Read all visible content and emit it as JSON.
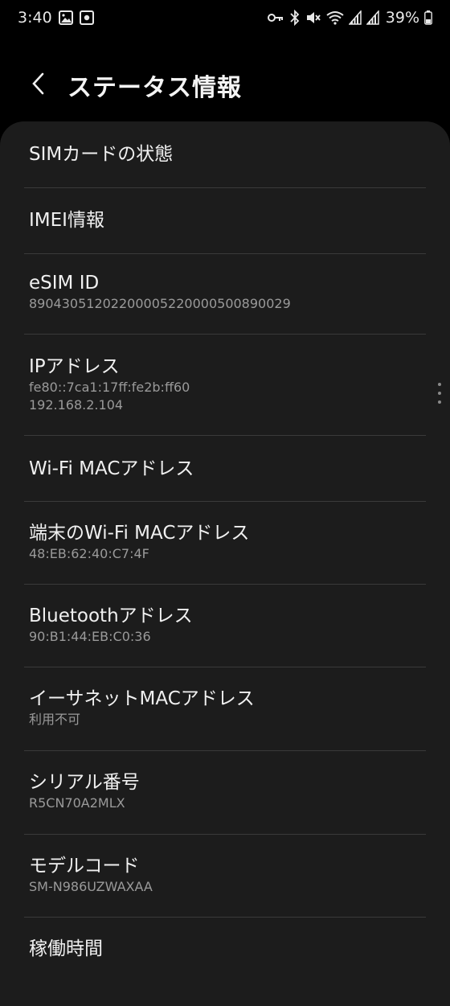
{
  "status_bar": {
    "time": "3:40",
    "battery": "39%"
  },
  "header": {
    "title": "ステータス情報"
  },
  "items": [
    {
      "title": "SIMカードの状態"
    },
    {
      "title": "IMEI情報"
    },
    {
      "title": "eSIM ID",
      "sub": "89043051202200005220000500890029"
    },
    {
      "title": "IPアドレス",
      "sub": "fe80::7ca1:17ff:fe2b:ff60",
      "sub2": "192.168.2.104"
    },
    {
      "title": "Wi-Fi MACアドレス"
    },
    {
      "title": "端末のWi-Fi MACアドレス",
      "sub": "48:EB:62:40:C7:4F"
    },
    {
      "title": "Bluetoothアドレス",
      "sub": "90:B1:44:EB:C0:36"
    },
    {
      "title": "イーサネットMACアドレス",
      "sub": "利用不可"
    },
    {
      "title": "シリアル番号",
      "sub": "R5CN70A2MLX"
    },
    {
      "title": "モデルコード",
      "sub": "SM-N986UZWAXAA"
    },
    {
      "title": "稼働時間"
    }
  ]
}
